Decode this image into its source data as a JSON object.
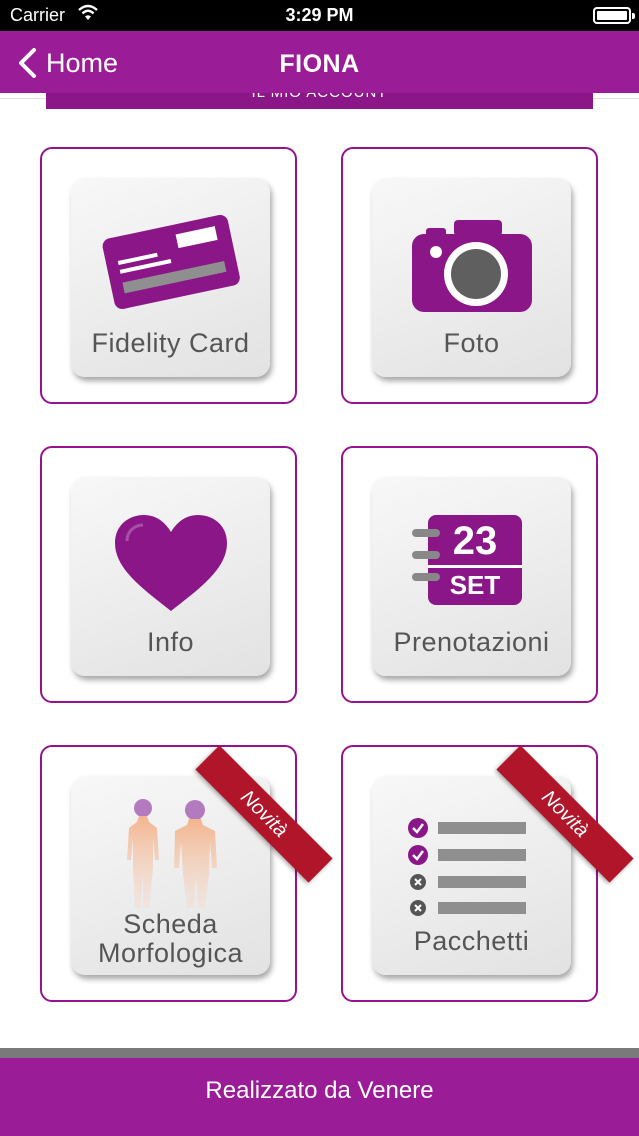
{
  "status": {
    "carrier": "Carrier",
    "time": "3:29 PM"
  },
  "nav": {
    "back_label": "Home",
    "title": "FIONA"
  },
  "account_bar": {
    "label": "IL MIO ACCOUNT"
  },
  "tiles": [
    {
      "label": "Fidelity Card",
      "icon": "credit-card-icon"
    },
    {
      "label": "Foto",
      "icon": "camera-icon"
    },
    {
      "label": "Info",
      "icon": "heart-icon"
    },
    {
      "label": "Prenotazioni",
      "icon": "calendar-icon",
      "calendar_day": "23",
      "calendar_month": "SET"
    },
    {
      "label_line1": "Scheda",
      "label_line2": "Morfologica",
      "icon": "body-silhouettes-icon",
      "badge": "Novità"
    },
    {
      "label": "Pacchetti",
      "icon": "checklist-icon",
      "badge": "Novità"
    }
  ],
  "footer": {
    "text": "Realizzato da Venere"
  },
  "colors": {
    "brand": "#9b1c97",
    "ribbon": "#b0152a",
    "tile_border": "#96138f"
  }
}
